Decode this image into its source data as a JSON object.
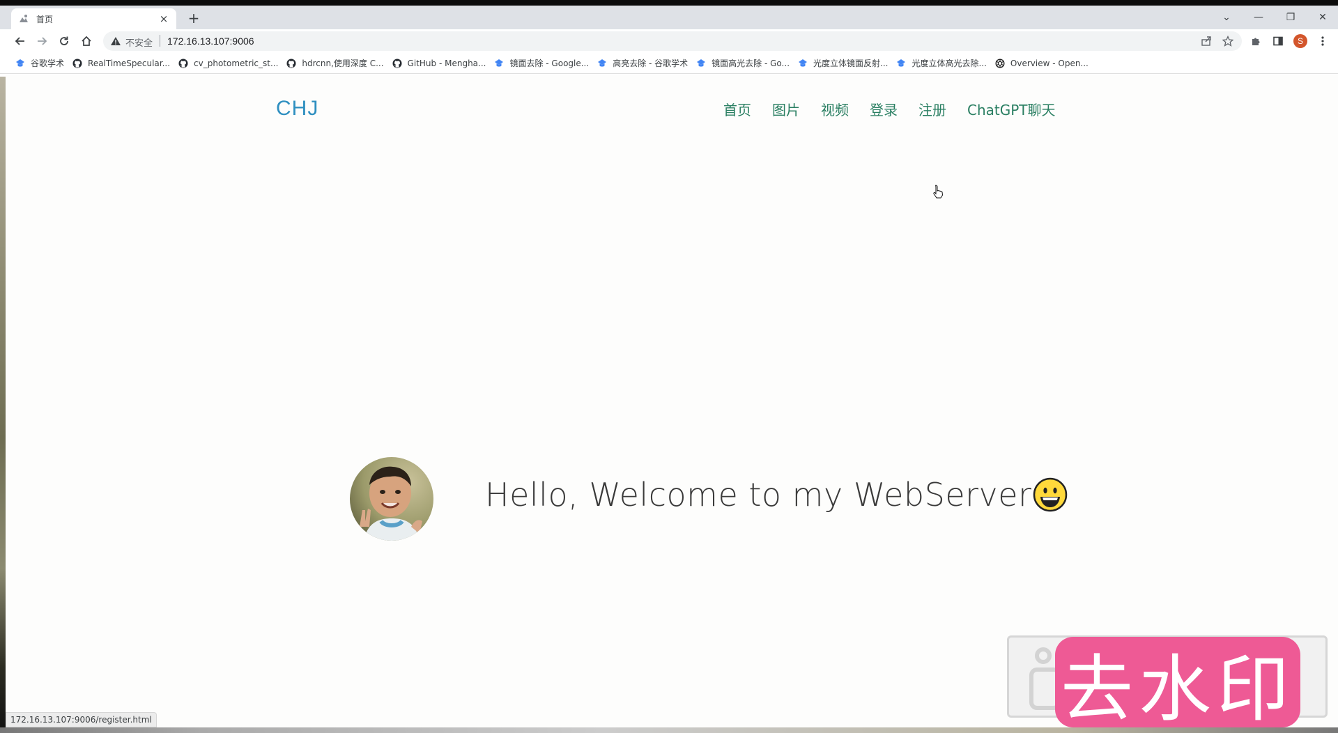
{
  "browser": {
    "tab": {
      "title": "首页",
      "close_label": "×"
    },
    "new_tab_label": "+",
    "window_controls": {
      "dropdown": "⌄",
      "minimize": "—",
      "restore": "❐",
      "close": "✕"
    },
    "address_bar": {
      "security_label": "不安全",
      "url": "172.16.13.107:9006"
    },
    "profile_initial": "S",
    "bookmarks": [
      {
        "label": "谷歌学术",
        "icon": "scholar-icon"
      },
      {
        "label": "RealTimeSpecular...",
        "icon": "github-icon"
      },
      {
        "label": "cv_photometric_st...",
        "icon": "github-icon"
      },
      {
        "label": "hdrcnn,使用深度 C...",
        "icon": "github-icon"
      },
      {
        "label": "GitHub - Mengha...",
        "icon": "github-icon"
      },
      {
        "label": "镜面去除 - Google...",
        "icon": "scholar-icon"
      },
      {
        "label": "高亮去除 - 谷歌学术",
        "icon": "scholar-icon"
      },
      {
        "label": "镜面高光去除 - Go...",
        "icon": "scholar-icon"
      },
      {
        "label": "光度立体镜面反射...",
        "icon": "scholar-icon"
      },
      {
        "label": "光度立体高光去除...",
        "icon": "scholar-icon"
      },
      {
        "label": "Overview - Open...",
        "icon": "openai-icon"
      }
    ],
    "status_url": "172.16.13.107:9006/register.html"
  },
  "site": {
    "brand": "CHJ",
    "nav": [
      "首页",
      "图片",
      "视频",
      "登录",
      "注册",
      "ChatGPT聊天"
    ],
    "welcome": "Hello, Welcome to my WebServer"
  },
  "watermark": {
    "text": "去水印"
  },
  "colors": {
    "brand": "#2e8fc0",
    "nav": "#2a7f62",
    "watermark": "#ee5a95",
    "profile": "#d3562c"
  }
}
